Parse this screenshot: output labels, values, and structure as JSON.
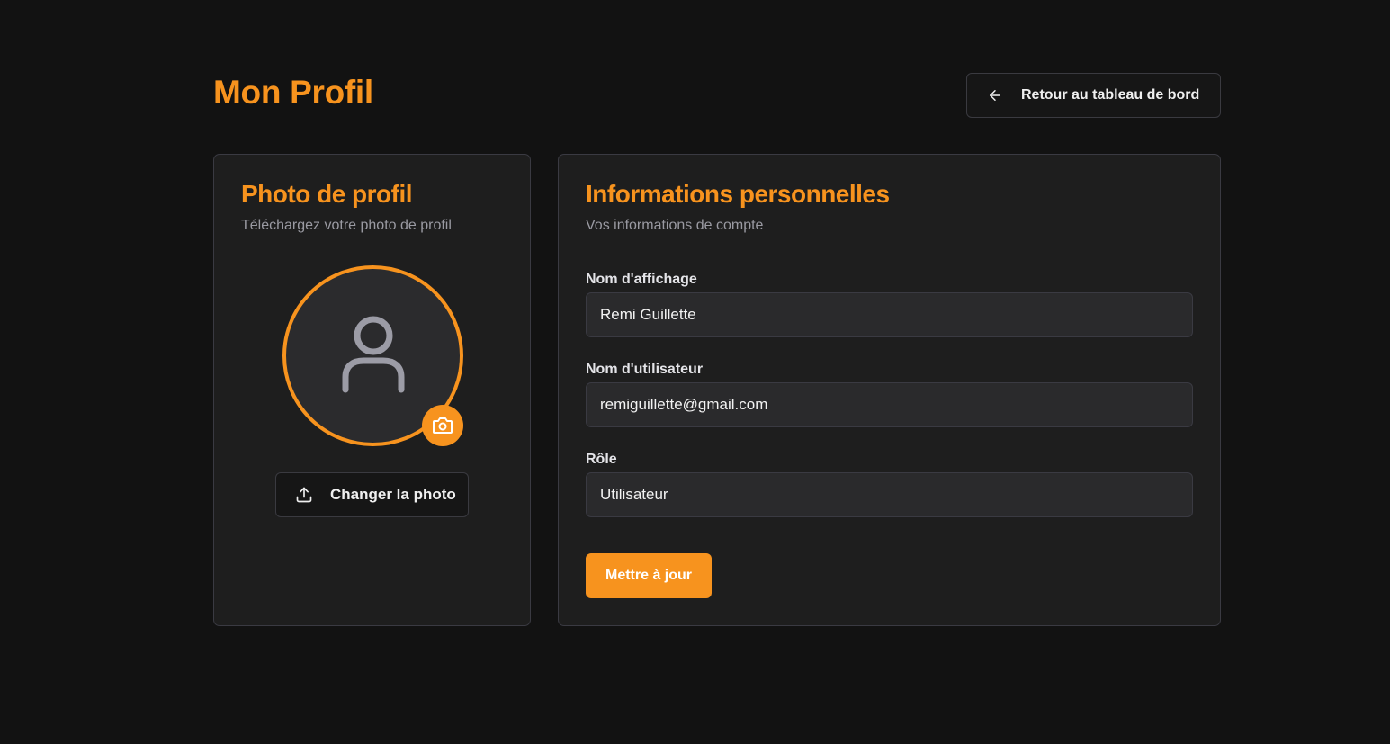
{
  "header": {
    "title": "Mon Profil",
    "back_button_label": "Retour au tableau de bord"
  },
  "photo_card": {
    "title": "Photo de profil",
    "subtitle": "Téléchargez votre photo de profil",
    "change_photo_label": "Changer la photo"
  },
  "info_card": {
    "title": "Informations personnelles",
    "subtitle": "Vos informations de compte",
    "fields": [
      {
        "label": "Nom d'affichage",
        "value": "Remi Guillette"
      },
      {
        "label": "Nom d'utilisateur",
        "value": "remiguillette@gmail.com"
      },
      {
        "label": "Rôle",
        "value": "Utilisateur"
      }
    ],
    "update_label": "Mettre à jour"
  },
  "colors": {
    "accent": "#f7931e",
    "background": "#121212",
    "card": "#1e1e1e"
  },
  "icons": [
    "arrow-left-icon",
    "user-icon",
    "camera-icon",
    "upload-icon"
  ]
}
